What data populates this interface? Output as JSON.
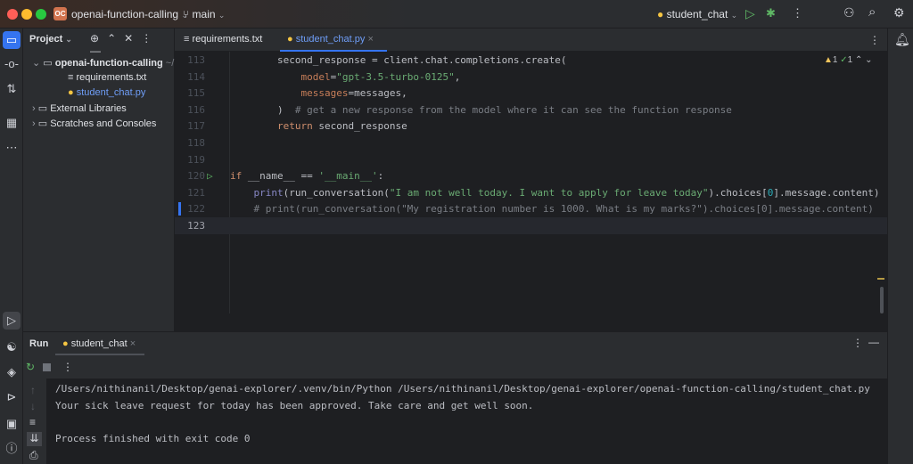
{
  "titlebar": {
    "project_badge": "OC",
    "project_name": "openai-function-calling",
    "branch": "main",
    "run_config": "student_chat"
  },
  "project_panel": {
    "title": "Project",
    "tree": [
      {
        "label": "openai-function-calling",
        "suffix": "~/Des",
        "level": 0,
        "expanded": true
      },
      {
        "label": "requirements.txt",
        "level": 1
      },
      {
        "label": "student_chat.py",
        "level": 1,
        "active": true
      },
      {
        "label": "External Libraries",
        "level": 0
      },
      {
        "label": "Scratches and Consoles",
        "level": 0
      }
    ]
  },
  "editor": {
    "tabs": [
      {
        "label": "requirements.txt",
        "active": false
      },
      {
        "label": "student_chat.py",
        "active": true
      }
    ],
    "inspections": {
      "warnings": "1",
      "ok": "1"
    },
    "lines": [
      {
        "n": "113",
        "tokens": [
          [
            "        ",
            "plain"
          ],
          [
            "second_response = client.chat.completions.create(",
            "plain"
          ]
        ]
      },
      {
        "n": "114",
        "tokens": [
          [
            "            ",
            "plain"
          ],
          [
            "model",
            "param"
          ],
          [
            "=",
            "plain"
          ],
          [
            "\"gpt-3.5-turbo-0125\"",
            "str"
          ],
          [
            ",",
            "plain"
          ]
        ]
      },
      {
        "n": "115",
        "tokens": [
          [
            "            ",
            "plain"
          ],
          [
            "messages",
            "param"
          ],
          [
            "=messages,",
            "plain"
          ]
        ]
      },
      {
        "n": "116",
        "tokens": [
          [
            "        ",
            "plain"
          ],
          [
            ")  ",
            "plain"
          ],
          [
            "# get a new response from the model where it can see the function response",
            "cmt"
          ]
        ]
      },
      {
        "n": "117",
        "tokens": [
          [
            "        ",
            "plain"
          ],
          [
            "return",
            "kw"
          ],
          [
            " second_response",
            "plain"
          ]
        ]
      },
      {
        "n": "118",
        "tokens": []
      },
      {
        "n": "119",
        "tokens": []
      },
      {
        "n": "120",
        "tokens": [
          [
            "if",
            "kw"
          ],
          [
            " __name__ == ",
            "plain"
          ],
          [
            "'__main__'",
            "str"
          ],
          [
            ":",
            "plain"
          ]
        ]
      },
      {
        "n": "121",
        "tokens": [
          [
            "    ",
            "plain"
          ],
          [
            "print",
            "builtin"
          ],
          [
            "(run_conversation(",
            "plain"
          ],
          [
            "\"I am not well today. I want to apply for leave today\"",
            "str"
          ],
          [
            ").choices[",
            "plain"
          ],
          [
            "0",
            "num"
          ],
          [
            "].message.content)",
            "plain"
          ]
        ]
      },
      {
        "n": "122",
        "tokens": [
          [
            "    ",
            "plain"
          ],
          [
            "# print(run_conversation(\"My registration number is 1000. What is my marks?\").choices[0].message.content)",
            "cmt"
          ]
        ]
      },
      {
        "n": "123",
        "tokens": []
      }
    ]
  },
  "run_panel": {
    "title": "Run",
    "tab": "student_chat",
    "output": [
      "/Users/nithinanil/Desktop/genai-explorer/.venv/bin/Python /Users/nithinanil/Desktop/genai-explorer/openai-function-calling/student_chat.py",
      "Your sick leave request for today has been approved. Take care and get well soon.",
      "",
      "Process finished with exit code 0"
    ]
  }
}
